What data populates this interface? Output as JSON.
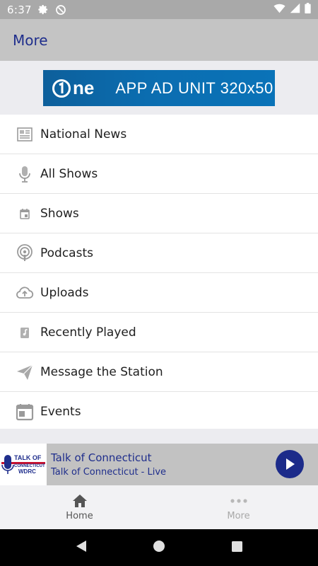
{
  "status_bar": {
    "time": "6:37"
  },
  "header": {
    "title": "More"
  },
  "ad": {
    "brand": "ne",
    "text": "APP AD UNIT 320x50"
  },
  "menu": {
    "items": [
      {
        "label": "National News",
        "icon": "newspaper-icon"
      },
      {
        "label": "All Shows",
        "icon": "microphone-icon"
      },
      {
        "label": "Shows",
        "icon": "calendar-small-icon"
      },
      {
        "label": "Podcasts",
        "icon": "podcast-icon"
      },
      {
        "label": "Uploads",
        "icon": "cloud-upload-icon"
      },
      {
        "label": "Recently Played",
        "icon": "music-note-icon"
      },
      {
        "label": "Message the Station",
        "icon": "send-icon"
      },
      {
        "label": "Events",
        "icon": "calendar-icon"
      }
    ]
  },
  "player": {
    "logo_top": "TALK OF",
    "logo_mid": "CONNECTICUT",
    "logo_bottom": "WDRC",
    "title": "Talk of Connecticut",
    "subtitle": "Talk of Connecticut - Live"
  },
  "tabs": {
    "home": "Home",
    "more": "More"
  },
  "colors": {
    "accent": "#1c2b8a",
    "header_bg": "#c4c4c4",
    "status_bg": "#a9a9a9"
  }
}
